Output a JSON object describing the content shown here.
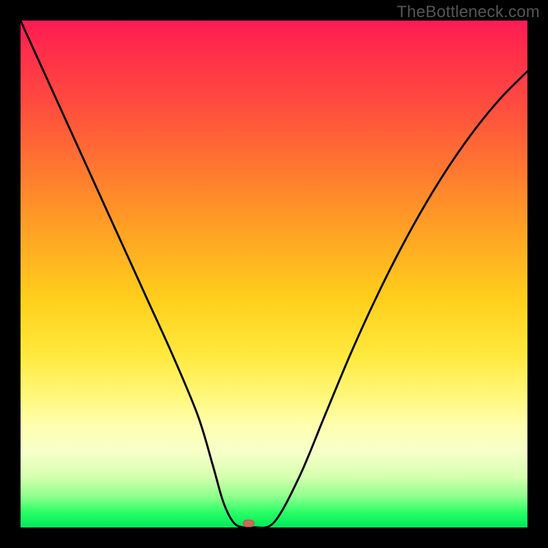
{
  "watermark": "TheBottleneck.com",
  "chart_data": {
    "type": "line",
    "title": "",
    "xlabel": "",
    "ylabel": "",
    "xlim": [
      0,
      100
    ],
    "ylim": [
      0,
      100
    ],
    "grid": false,
    "legend": false,
    "series": [
      {
        "name": "curve",
        "x": [
          0,
          5,
          10,
          15,
          20,
          25,
          30,
          35,
          38,
          40,
          42,
          44,
          46,
          50,
          55,
          60,
          65,
          70,
          75,
          80,
          85,
          90,
          95,
          100
        ],
        "y": [
          100,
          89,
          78,
          67,
          56,
          45,
          34,
          22,
          12,
          5,
          1,
          0,
          0,
          1,
          10,
          22,
          34,
          45,
          55,
          64,
          72,
          79,
          85,
          90
        ]
      }
    ],
    "annotations": [
      {
        "name": "minimum-marker",
        "x": 45,
        "y": 0.8
      }
    ],
    "background_gradient": {
      "direction": "top-to-bottom",
      "stops": [
        {
          "pos": 0,
          "color": "#ff1a55"
        },
        {
          "pos": 30,
          "color": "#ff7a2f"
        },
        {
          "pos": 60,
          "color": "#ffe93d"
        },
        {
          "pos": 85,
          "color": "#f7ffc9"
        },
        {
          "pos": 100,
          "color": "#00e85a"
        }
      ]
    }
  }
}
